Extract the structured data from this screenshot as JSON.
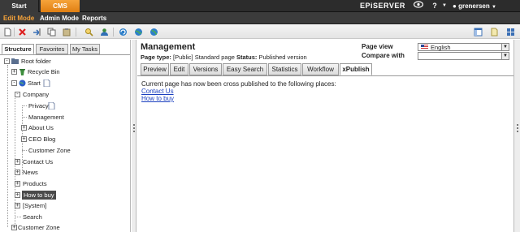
{
  "topbar": {
    "tabs": [
      "Start",
      "CMS"
    ],
    "brand": "EPiSERVER",
    "help": "?",
    "user": "grenersen"
  },
  "modebar": {
    "items": [
      "Edit Mode",
      "Admin Mode",
      "Reports"
    ],
    "active": "Edit Mode"
  },
  "toolbar": {
    "icons": [
      "new-page-icon",
      "delete-icon",
      "move-icon",
      "copy-icon",
      "paste-icon",
      "search-icon",
      "users-icon",
      "refresh-icon",
      "globe-icon",
      "globe-alt-icon",
      "layout-icon",
      "document-icon",
      "tiles-icon"
    ]
  },
  "left": {
    "tabs": [
      "Structure",
      "Favorites",
      "My Tasks"
    ],
    "active_tab": "Structure",
    "tree": [
      {
        "label": "Root folder"
      },
      {
        "label": "Recycle Bin"
      },
      {
        "label": "Start"
      },
      {
        "label": "Company"
      },
      {
        "label": "Privacy"
      },
      {
        "label": "Management"
      },
      {
        "label": "About Us"
      },
      {
        "label": "CEO Blog"
      },
      {
        "label": "Customer Zone"
      },
      {
        "label": "Contact Us"
      },
      {
        "label": "News"
      },
      {
        "label": "Products"
      },
      {
        "label": "How to buy"
      },
      {
        "label": "[System]"
      },
      {
        "label": "Search"
      },
      {
        "label": "Customer Zone"
      }
    ],
    "selected": "How to buy"
  },
  "main": {
    "title": "Management",
    "page_type_label": "Page type:",
    "page_type_value": "[Public] Standard page",
    "status_label": "Status:",
    "status_value": "Published version",
    "page_view_label": "Page view",
    "page_view_value": "English",
    "compare_with_label": "Compare with",
    "compare_with_value": "",
    "tabs": [
      "Preview",
      "Edit",
      "Versions",
      "Easy Search",
      "Statistics",
      "Workflow",
      "xPublish"
    ],
    "active_tab": "xPublish",
    "message": "Current page has now been cross published to the following places:",
    "links": [
      "Contact Us",
      "How to buy"
    ]
  },
  "colors": {
    "accent": "#f6a33a",
    "topbar": "#2c2c2c",
    "link": "#1a3fbf"
  }
}
